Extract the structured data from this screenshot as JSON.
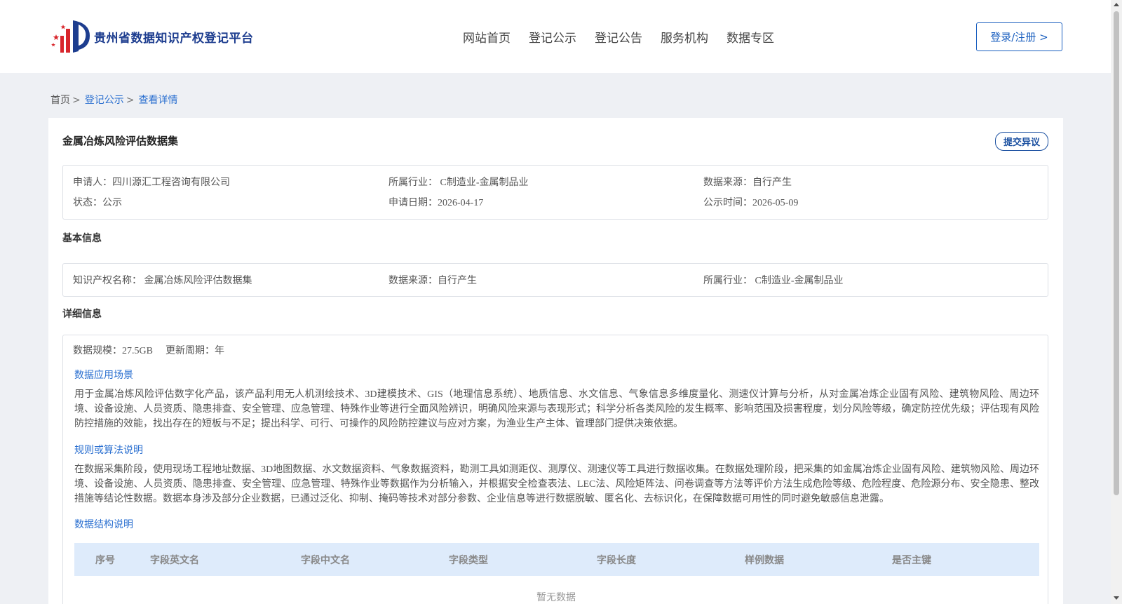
{
  "header": {
    "logo_text": "贵州省数据知识产权登记平台",
    "nav": [
      "网站首页",
      "登记公示",
      "登记公告",
      "服务机构",
      "数据专区"
    ],
    "login_label": "登录/注册 >"
  },
  "breadcrumb": {
    "home": "首页",
    "level1": "登记公示",
    "current": "查看详情",
    "sep": ">"
  },
  "detail": {
    "title": "金属冶炼风险评估数据集",
    "objection_label": "提交异议",
    "summary": {
      "applicant": "申请人：四川源汇工程咨询有限公司",
      "industry": "所属行业： C制造业-金属制品业",
      "source": "数据来源：自行产生",
      "status": "状态：公示",
      "apply_date": "申请日期：2026-04-17",
      "publish_date": "公示时间：2026-05-09"
    },
    "basic_title": "基本信息",
    "basic": {
      "name": "知识产权名称： 金属冶炼风险评估数据集",
      "source": "数据来源：自行产生",
      "industry": "所属行业： C制造业-金属制品业"
    },
    "detail_title": "详细信息",
    "scale": "数据规模：27.5GB",
    "cycle": "更新周期：年",
    "scenario_title": "数据应用场景",
    "scenario_text": "用于金属冶炼风险评估数字化产品，该产品利用无人机测绘技术、3D建模技术、GIS（地理信息系统）、地质信息、水文信息、气象信息多维度量化、测速仪计算与分析，从对金属冶炼企业固有风险、建筑物风险、周边环境、设备设施、人员资质、隐患排查、安全管理、应急管理、特殊作业等进行全面风险辨识，明确风险来源与表现形式；科学分析各类风险的发生概率、影响范围及损害程度，划分风险等级，确定防控优先级；评估现有风险防控措施的效能，找出存在的短板与不足；提出科学、可行、可操作的风险防控建议与应对方案，为渔业生产主体、管理部门提供决策依据。",
    "algorithm_title": "规则或算法说明",
    "algorithm_text": "在数据采集阶段，使用现场工程地址数据、3D地图数据、水文数据资料、气象数据资料，勘测工具如测距仪、测厚仪、测速仪等工具进行数据收集。在数据处理阶段，把采集的如金属冶炼企业固有风险、建筑物风险、周边环境、设备设施、人员资质、隐患排查、安全管理、应急管理、特殊作业等数据作为分析输入，并根据安全检查表法、LEC法、风险矩阵法、问卷调查等方法等评价方法生成危险等级、危险程度、危险源分布、安全隐患、整改措施等结论性数据。数据本身涉及部分企业数据，已通过泛化、抑制、掩码等技术对部分参数、企业信息等进行数据脱敏、匿名化、去标识化，在保障数据可用性的同时避免敏感信息泄露。",
    "structure_title": "数据结构说明",
    "table_headers": [
      "序号",
      "字段英文名",
      "字段中文名",
      "字段类型",
      "字段长度",
      "样例数据",
      "是否主键"
    ],
    "empty_text": "暂无数据"
  },
  "colors": {
    "brand": "#1d3d8f",
    "link": "#2a6fd0",
    "table_header_bg": "#deebfb"
  }
}
